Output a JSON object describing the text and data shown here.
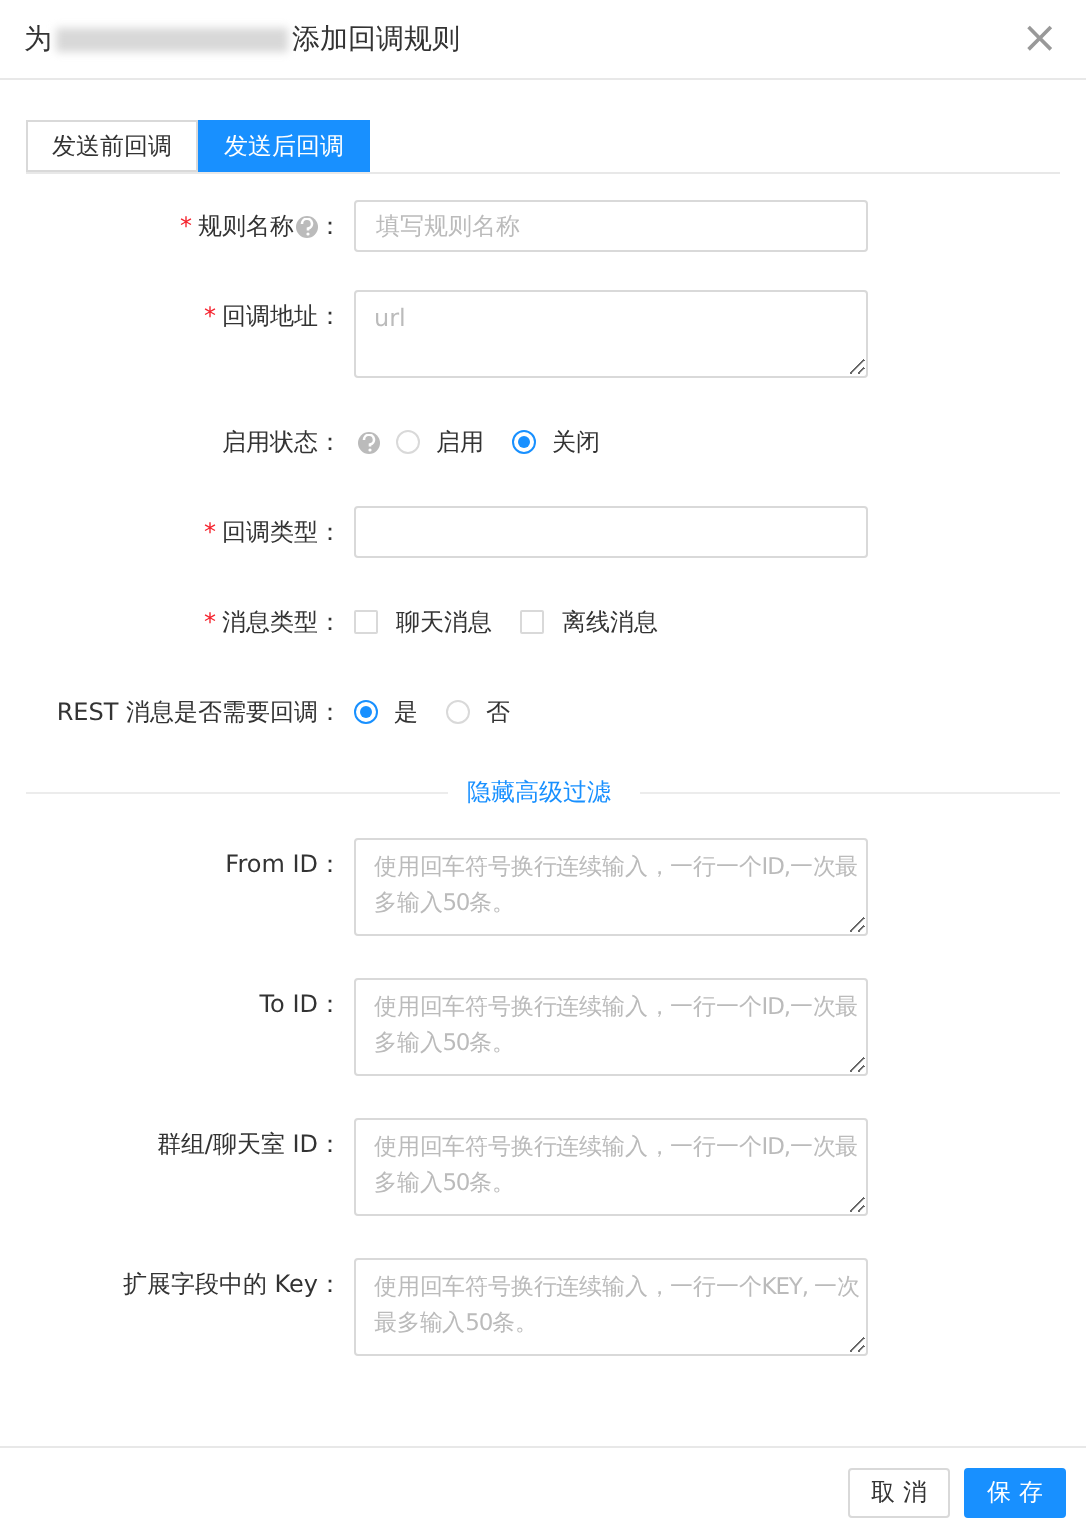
{
  "dialog": {
    "title_prefix": "为",
    "title_suffix": "添加回调规则",
    "close": "×"
  },
  "tabs": [
    {
      "label": "发送前回调",
      "selected": false
    },
    {
      "label": "发送后回调",
      "selected": true
    }
  ],
  "required_mark": "*",
  "form": [
    {
      "kind": "input",
      "label": "规则名称",
      "suffix": "：",
      "required": true,
      "help": true,
      "placeholder": "填写规则名称"
    },
    {
      "kind": "textarea",
      "label": "回调地址：",
      "required": true,
      "help": false,
      "placeholder": "url"
    },
    {
      "kind": "radio",
      "label": "启用状态：",
      "required": false,
      "help": true,
      "options": [
        {
          "label": "启用",
          "selected": false
        },
        {
          "label": "关闭",
          "selected": true
        }
      ]
    },
    {
      "kind": "input",
      "label": "回调类型：",
      "required": true,
      "help": false
    },
    {
      "kind": "checkbox",
      "label": "消息类型：",
      "required": true,
      "help": false,
      "options": [
        {
          "label": "聊天消息",
          "checked": false
        },
        {
          "label": "离线消息",
          "checked": false
        }
      ]
    },
    {
      "kind": "radio",
      "label": "REST 消息是否需要回调：",
      "required": false,
      "help": false,
      "options": [
        {
          "label": "是",
          "selected": true
        },
        {
          "label": "否",
          "selected": false
        }
      ]
    }
  ],
  "advanced_toggle": "隐藏高级过滤",
  "advanced": [
    {
      "kind": "textarea",
      "label": "From ID：",
      "required": false,
      "placeholder": "使用回车符号换行连续输入，一行一个ID,一次最多输入50条。"
    },
    {
      "kind": "textarea",
      "label": "To ID：",
      "required": false,
      "placeholder": "使用回车符号换行连续输入，一行一个ID,一次最多输入50条。"
    },
    {
      "kind": "textarea",
      "label": "群组/聊天室 ID：",
      "required": false,
      "placeholder": "使用回车符号换行连续输入，一行一个ID,一次最多输入50条。"
    },
    {
      "kind": "textarea",
      "label": "扩展字段中的 Key：",
      "required": false,
      "placeholder": "使用回车符号换行连续输入，一行一个KEY, 一次最多输入50条。"
    }
  ],
  "buttons": [
    {
      "label": "取 消",
      "kind": "default"
    },
    {
      "label": "保 存",
      "kind": "primary"
    }
  ]
}
